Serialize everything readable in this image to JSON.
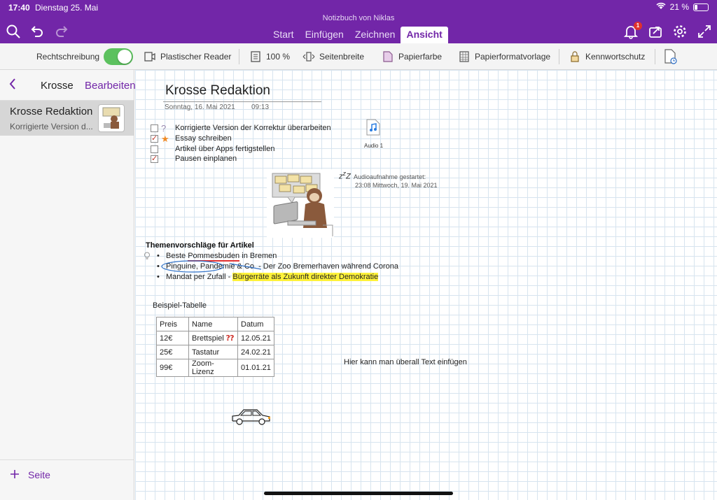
{
  "status": {
    "time": "17:40",
    "date": "Dienstag 25. Mai",
    "battery": "21 %",
    "battery_level": 0.21
  },
  "header": {
    "notebook_title": "Notizbuch von Niklas",
    "notification_count": "1"
  },
  "tabs": [
    {
      "label": "Start"
    },
    {
      "label": "Einfügen"
    },
    {
      "label": "Zeichnen"
    },
    {
      "label": "Ansicht",
      "active": true
    }
  ],
  "ribbon": {
    "spelling": "Rechtschreibung",
    "reader": "Plastischer Reader",
    "zoom": "100 %",
    "page_width": "Seitenbreite",
    "paper_color": "Papierfarbe",
    "paper_template": "Papierformatvorlage",
    "password": "Kennwortschutz"
  },
  "sidebar": {
    "section": "Krosse",
    "edit": "Bearbeiten",
    "page_title": "Krosse Redaktion",
    "page_preview": "Korrigierte Version d...",
    "add_page": "Seite"
  },
  "page": {
    "title": "Krosse Redaktion",
    "date": "Sonntag, 16. Mai 2021",
    "time": "09:13",
    "todos": [
      {
        "text": "Korrigierte Version der Korrektur überarbeiten",
        "checked": false,
        "tag": "?"
      },
      {
        "text": "Essay schreiben",
        "checked": true,
        "tag": "★"
      },
      {
        "text": "Artikel über Apps fertigstellen",
        "checked": false,
        "tag": ""
      },
      {
        "text": "Pausen einplanen",
        "checked": true,
        "tag": ""
      }
    ],
    "audio_label": "Audio 1",
    "recording_line1": "Audioaufnahme gestartet:",
    "recording_line2": "23:08 Mittwoch, 19. Mai 2021",
    "topics_heading": "Themenvorschläge für Artikel",
    "topic1_pre": "Beste ",
    "topic1_ul": "Pommesbuden",
    "topic1_post": " in Bremen",
    "topic2": "Pinguine, Pandemie & Co. - Der Zoo Bremerhaven während Corona",
    "topic3_pre": "Mandat per Zufall - ",
    "topic3_hl": "Bürgerräte als Zukunft direkter Demokratie",
    "table_label": "Beispiel-Tabelle",
    "table_headers": [
      "Preis",
      "Name",
      "Datum"
    ],
    "table_rows": [
      [
        "12€",
        "Brettspiel",
        "12.05.21"
      ],
      [
        "25€",
        "Tastatur",
        "24.02.21"
      ],
      [
        "99€",
        "Zoom-Lizenz",
        "01.01.21"
      ]
    ],
    "free_text": "Hier kann man überall Text einfügen"
  }
}
